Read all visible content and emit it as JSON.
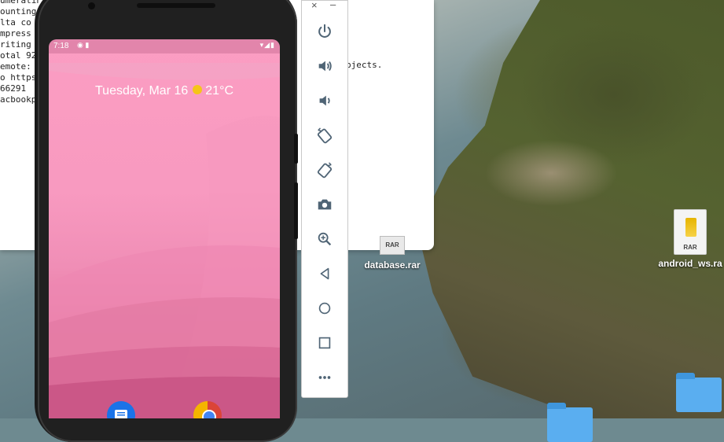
{
  "terminal": {
    "left_lines": [
      "umeratin",
      "ounting",
      "lta co",
      "mpress",
      "riting",
      "otal 92",
      "emote:",
      "o https",
      "  66291",
      "acbookp"
    ],
    "right_text": "bjects."
  },
  "desktop": {
    "icons": [
      {
        "label": "database.rar",
        "type_tag": "RAR"
      },
      {
        "label": "android_ws.ra",
        "type_tag": "RAR"
      }
    ]
  },
  "phone": {
    "status_time": "7:18",
    "status_icons": "◉ ▮",
    "status_right": "▾◢▮",
    "date_text": "Tuesday, Mar 16",
    "temperature": "21°C"
  },
  "emulator": {
    "close_label": "×",
    "minimize_label": "–",
    "buttons": [
      "power-icon",
      "volume-up-icon",
      "volume-down-icon",
      "rotate-left-icon",
      "rotate-right-icon",
      "camera-icon",
      "zoom-icon",
      "back-icon",
      "home-icon",
      "overview-icon",
      "more-icon"
    ]
  }
}
